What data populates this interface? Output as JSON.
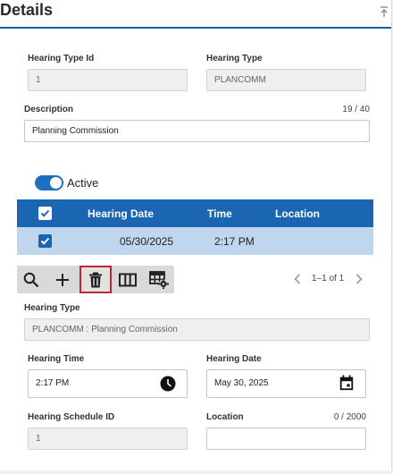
{
  "header": {
    "title": "Details"
  },
  "fields": {
    "hearing_type_id": {
      "label": "Hearing Type Id",
      "value": "1"
    },
    "hearing_type": {
      "label": "Hearing Type",
      "value": "PLANCOMM"
    },
    "description": {
      "label": "Description",
      "value": "Planning Commission",
      "counter": "19 / 40"
    }
  },
  "active_toggle": {
    "label": "Active",
    "on": true
  },
  "table": {
    "columns": [
      "Hearing Date",
      "Time",
      "Location"
    ],
    "rows": [
      {
        "hearing_date": "05/30/2025",
        "time": "2:17 PM",
        "location": ""
      }
    ]
  },
  "toolbar": {
    "icons": [
      "search-icon",
      "add-icon",
      "delete-icon",
      "columns-icon",
      "table-settings-icon"
    ]
  },
  "pager": {
    "text": "1–1 of 1"
  },
  "detail": {
    "hearing_type": {
      "label": "Hearing Type",
      "value": "PLANCOMM : Planning Commission"
    },
    "hearing_time": {
      "label": "Hearing Time",
      "value": "2:17 PM"
    },
    "hearing_date": {
      "label": "Hearing Date",
      "value": "May 30, 2025"
    },
    "schedule_id": {
      "label": "Hearing Schedule ID",
      "value": "1"
    },
    "location": {
      "label": "Location",
      "value": "",
      "counter": "0 / 2000"
    }
  },
  "colors": {
    "accent": "#1f6fc0",
    "table_header": "#1a66b3",
    "selected_row": "#bfd6ee",
    "focus_outline": "#c0262d"
  }
}
